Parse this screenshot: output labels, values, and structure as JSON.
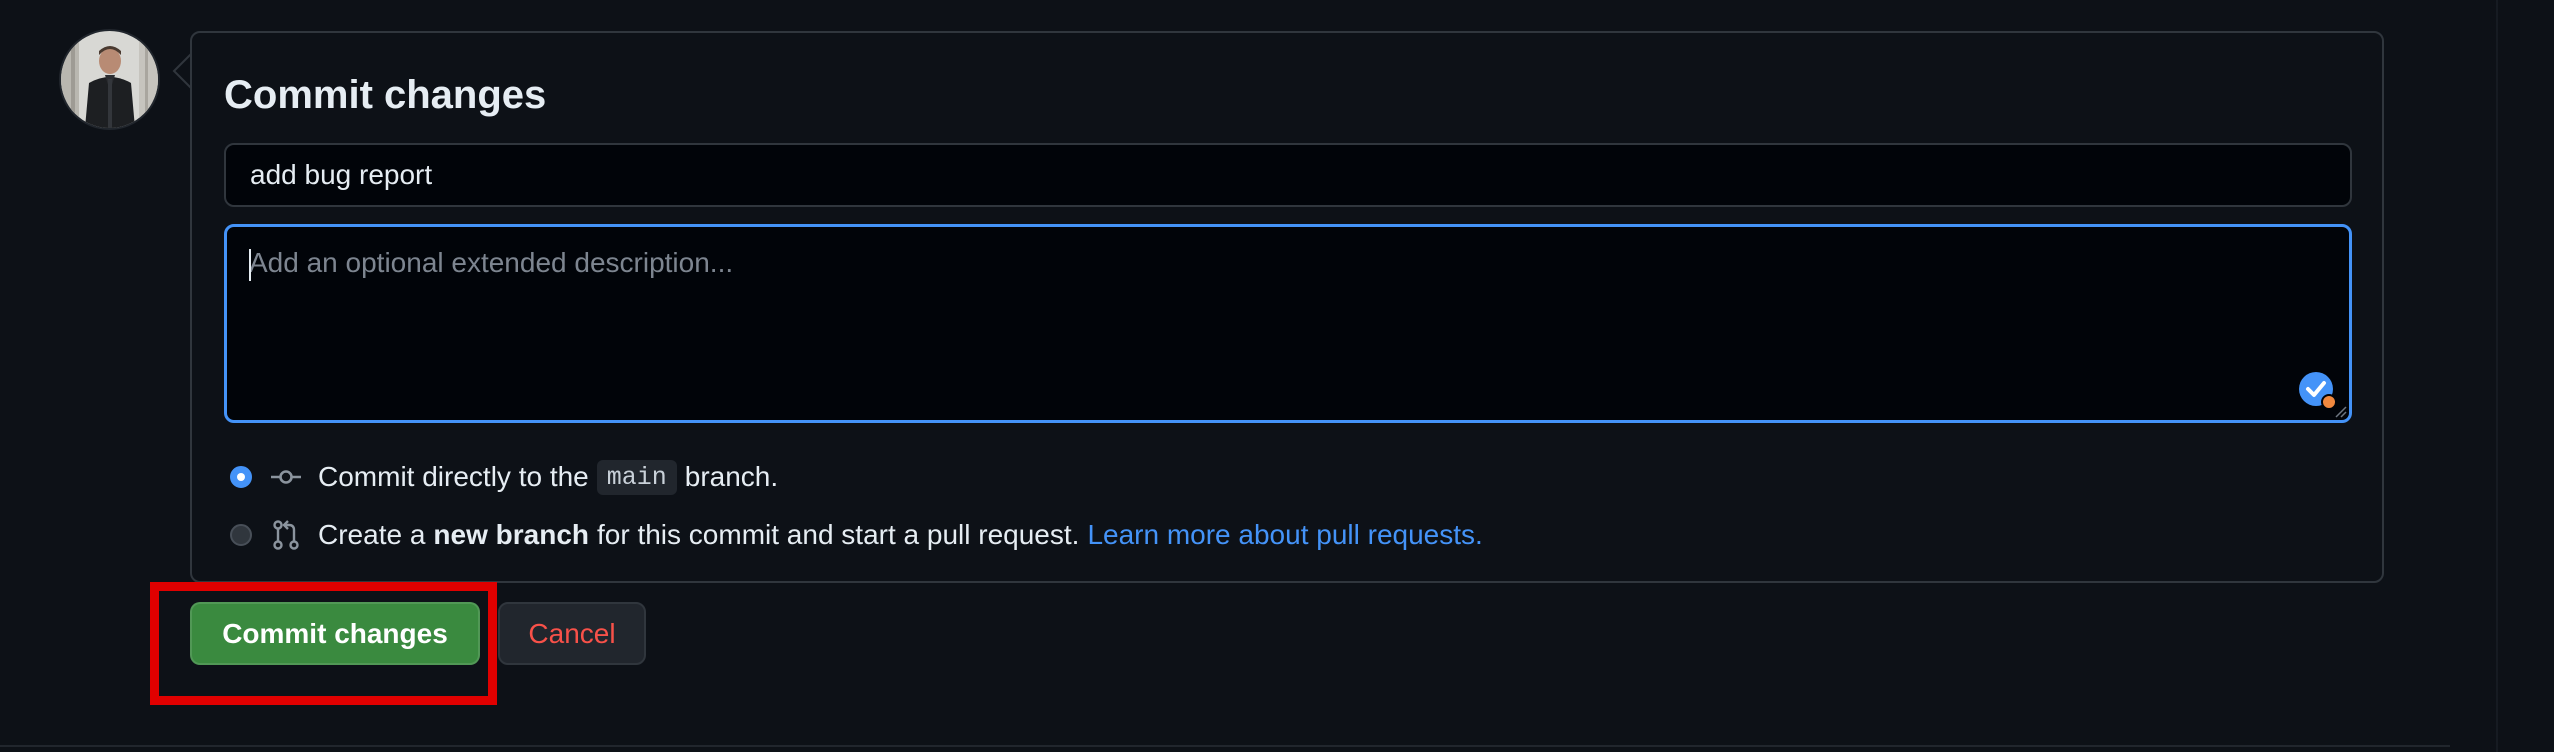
{
  "panel": {
    "title": "Commit changes"
  },
  "commit_message": {
    "value": "add bug report"
  },
  "description": {
    "placeholder": "Add an optional extended description..."
  },
  "options": {
    "direct": {
      "prefix": "Commit directly to the",
      "branch": "main",
      "suffix": "branch.",
      "selected": true,
      "icon": "git-commit-icon"
    },
    "new_branch": {
      "prefix": "Create a",
      "bold": "new branch",
      "suffix": "for this commit and start a pull request.",
      "link": "Learn more about pull requests.",
      "selected": false,
      "icon": "git-pull-request-icon"
    }
  },
  "actions": {
    "commit_label": "Commit changes",
    "cancel_label": "Cancel"
  },
  "colors": {
    "accent_blue": "#4493f8",
    "commit_green": "#3a8a3f",
    "cancel_red": "#f85149",
    "highlight_red": "#e00000",
    "background": "#0d1117"
  }
}
